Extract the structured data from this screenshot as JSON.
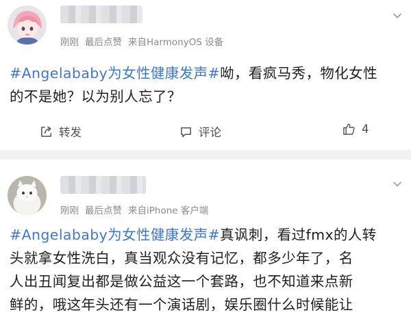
{
  "posts": [
    {
      "avatar": "avatar-pink-hair-anime",
      "meta": {
        "time": "刚刚",
        "edited": "最后点赞",
        "source": "来自HarmonyOS 设备"
      },
      "content": {
        "topic": "#Angelababy为女性健康发声#",
        "text_line1": "呦，看疯马秀，物化女性",
        "text_line2": "的不是她？以为别人忘了？"
      },
      "actions": {
        "repost_label": "转发",
        "comment_label": "评论",
        "like_count": "4"
      }
    },
    {
      "avatar": "avatar-white-cat",
      "meta": {
        "time": "刚刚",
        "edited": "最后点赞",
        "source": "来自iPhone 客户端"
      },
      "content": {
        "topic": "#Angelababy为女性健康发声#",
        "text_line1": "真讽刺，看过fmx的人转",
        "text_line2": "头就拿女性洗白，真当观众没有记忆，都多少年了，名",
        "text_line3": "人出丑闻复出都是做公益这一个套路，也不知道来点新",
        "text_line4": "鲜的，哦这年头还有一个演话剧，娱乐圈什么时候能让"
      }
    }
  ],
  "colors": {
    "topic": "#3f78c9",
    "meta": "#8a8a8a",
    "separator": "#f2f2f2"
  },
  "icons": {
    "repost": "share-icon",
    "comment": "comment-icon",
    "like": "thumbs-up-icon",
    "more": "chevron-down-icon"
  }
}
